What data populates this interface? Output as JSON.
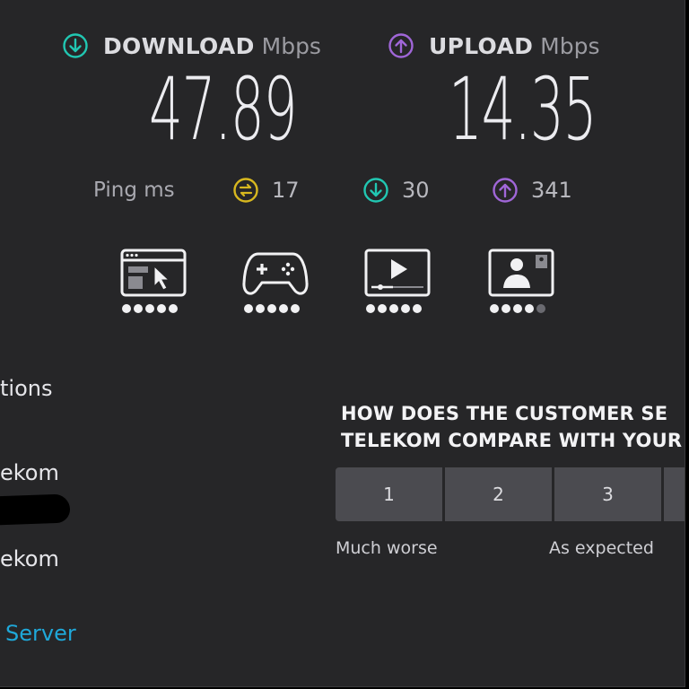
{
  "download": {
    "label": "DOWNLOAD",
    "unit": "Mbps",
    "value": "47.89",
    "color": "#21c7b2"
  },
  "upload": {
    "label": "UPLOAD",
    "unit": "Mbps",
    "value": "14.35",
    "color": "#a066d8"
  },
  "ping": {
    "label": "Ping ms",
    "idle": {
      "value": "17",
      "color": "#d8b81f"
    },
    "download": {
      "value": "30",
      "color": "#21c7b2"
    },
    "upload": {
      "value": "341",
      "color": "#a066d8"
    }
  },
  "quality_indicators": [
    {
      "icon": "browsing-icon",
      "rating": 5,
      "max": 5
    },
    {
      "icon": "gaming-icon",
      "rating": 5,
      "max": 5
    },
    {
      "icon": "streaming-icon",
      "rating": 5,
      "max": 5
    },
    {
      "icon": "video-call-icon",
      "rating": 4,
      "max": 5
    }
  ],
  "left": {
    "connections_label": "tions",
    "provider_label": "ekom",
    "server_provider_label": "ekom",
    "change_server_link": "Server"
  },
  "survey": {
    "question_line1": "HOW DOES THE CUSTOMER SE",
    "question_line2": "TELEKOM COMPARE WITH YOUR",
    "options": [
      "1",
      "2",
      "3",
      ""
    ],
    "scale_low": "Much worse",
    "scale_mid": "As expected"
  }
}
